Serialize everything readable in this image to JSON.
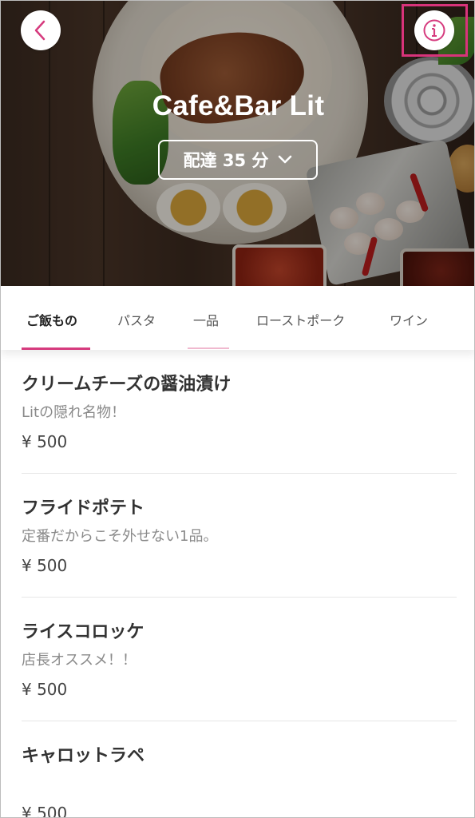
{
  "header": {
    "store_name": "Cafe&Bar Lit",
    "delivery_label": "配達 35 分",
    "back_icon": "chevron-left-icon",
    "info_icon": "info-icon",
    "accent_color": "#d63b7e",
    "highlight_color": "#d8337a"
  },
  "tabs": [
    {
      "label": "ご飯もの",
      "active": true
    },
    {
      "label": "パスタ",
      "active": false
    },
    {
      "label": "一品",
      "active": false
    },
    {
      "label": "ローストポーク",
      "active": false
    },
    {
      "label": "ワイン",
      "active": false
    }
  ],
  "menu": [
    {
      "name": "クリームチーズの醤油漬け",
      "description": "Litの隠れ名物！",
      "price": "¥ 500"
    },
    {
      "name": "フライドポテト",
      "description": "定番だからこそ外せない1品。",
      "price": "¥ 500"
    },
    {
      "name": "ライスコロッケ",
      "description": "店長オススメ！！",
      "price": "¥ 500"
    },
    {
      "name": "キャロットラペ",
      "description": "",
      "price": "¥ 500"
    }
  ]
}
